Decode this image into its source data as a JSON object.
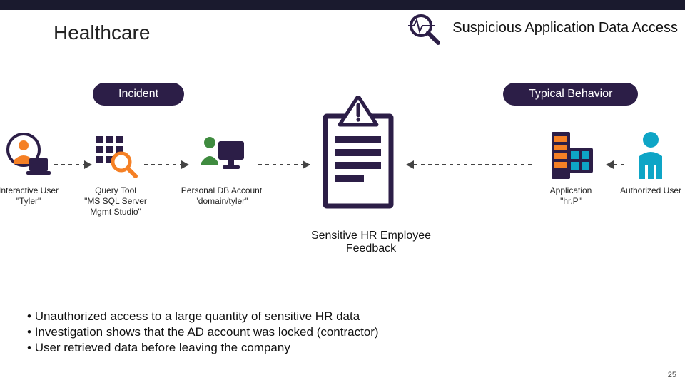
{
  "header": {
    "title_left": "Healthcare",
    "title_right": "Suspicious Application Data Access"
  },
  "pills": {
    "incident": "Incident",
    "typical": "Typical Behavior"
  },
  "nodes": {
    "user": {
      "l1": "Interactive User",
      "l2": "\"Tyler\""
    },
    "tool": {
      "l1": "Query Tool",
      "l2": "\"MS SQL Server",
      "l3": "Mgmt Studio\""
    },
    "acct": {
      "l1": "Personal DB Account",
      "l2": "\"domain/tyler\""
    },
    "doc": {
      "l1": "Sensitive HR Employee",
      "l2": "Feedback"
    },
    "app": {
      "l1": "Application",
      "l2": "\"hr.P\""
    },
    "auth": {
      "l1": "Authorized User"
    }
  },
  "bullets": [
    "Unauthorized access to a large quantity of sensitive HR data",
    "Investigation shows that the AD account was locked (contractor)",
    "User retrieved data before leaving the company"
  ],
  "page_number": "25",
  "colors": {
    "accent_dark": "#2c1e47",
    "orange": "#f58025",
    "blue": "#0ea5c6",
    "person_green": "#3f8b3f"
  }
}
